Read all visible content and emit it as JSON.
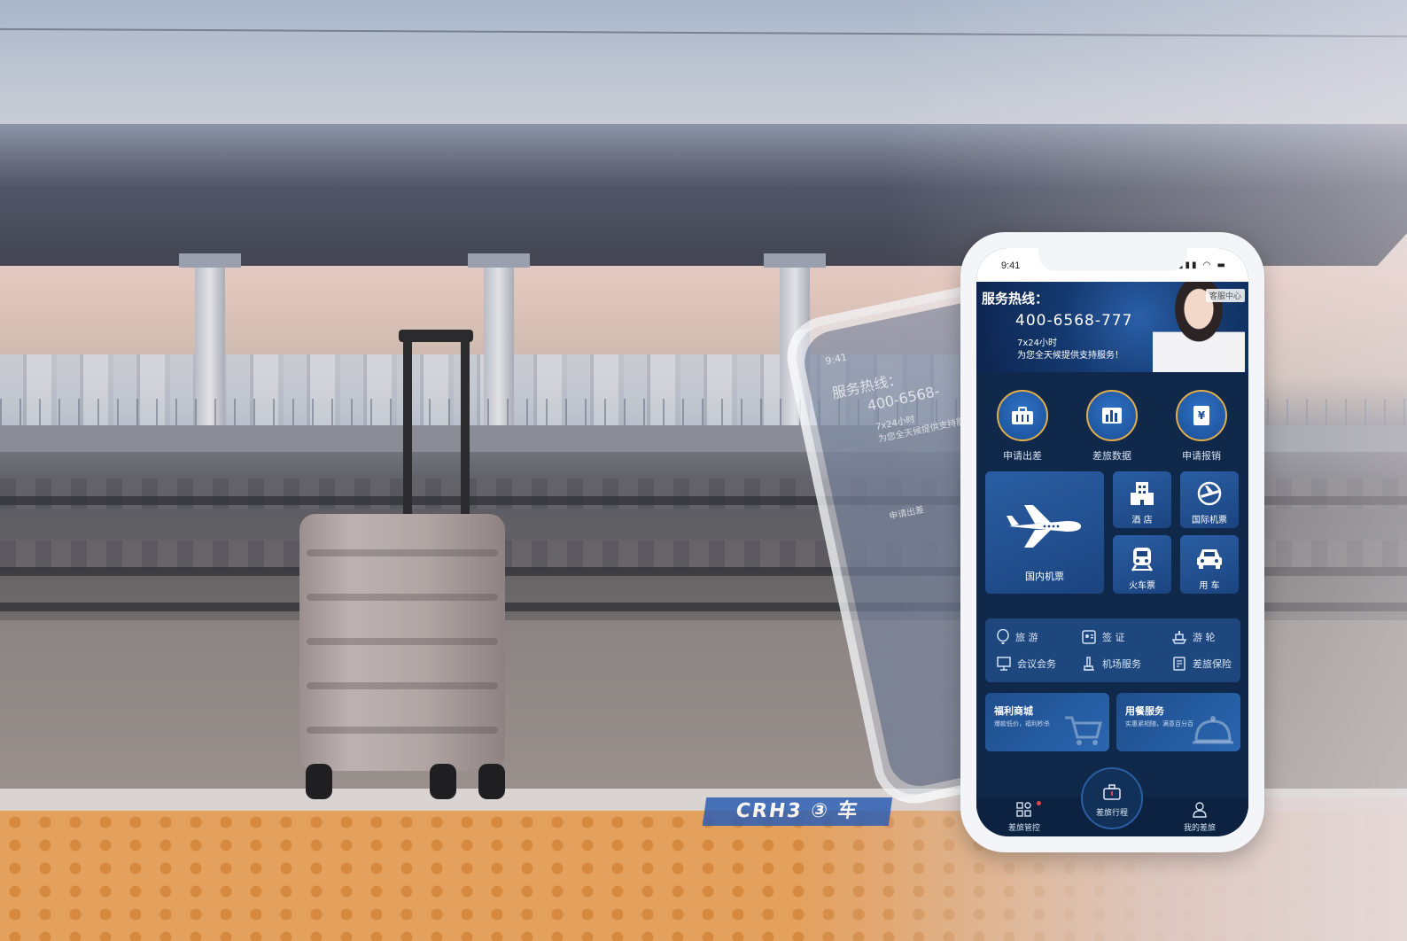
{
  "scene": {
    "platform_sign": "CRH3 ③ 车"
  },
  "ghost_phone": {
    "time": "9:41",
    "hotline_title": "服务热线：",
    "phone": "400-6568-",
    "hours": "7x24小时",
    "desc": "为您全天候提供支持服务",
    "apply_trip": "申请出差"
  },
  "phone": {
    "status": {
      "time": "9:41",
      "icons": "▮▮▮ ◠ ▬"
    },
    "banner": {
      "title": "服务热线：",
      "phone": "400-6568-777",
      "hours": "7x24小时",
      "desc": "为您全天候提供支持服务！",
      "badge": "客服中心"
    },
    "quick_actions": [
      {
        "label": "申请出差",
        "icon": "briefcase-icon"
      },
      {
        "label": "差旅数据",
        "icon": "bar-chart-icon"
      },
      {
        "label": "申请报销",
        "icon": "yen-receipt-icon"
      }
    ],
    "tiles": {
      "domestic_flight": {
        "label": "国内机票",
        "icon": "airplane-icon"
      },
      "hotel": {
        "label": "酒 店",
        "icon": "hotel-icon"
      },
      "intl_flight": {
        "label": "国际机票",
        "icon": "globe-plane-icon"
      },
      "train": {
        "label": "火车票",
        "icon": "train-icon"
      },
      "car": {
        "label": "用 车",
        "icon": "car-icon"
      }
    },
    "services": [
      {
        "label": "旅 游",
        "icon": "balloon-icon"
      },
      {
        "label": "签 证",
        "icon": "passport-icon"
      },
      {
        "label": "游 轮",
        "icon": "ship-icon"
      },
      {
        "label": "会议会务",
        "icon": "presentation-icon"
      },
      {
        "label": "机场服务",
        "icon": "airport-icon"
      },
      {
        "label": "差旅保险",
        "icon": "insurance-icon"
      }
    ],
    "promos": [
      {
        "title": "福利商城",
        "sub": "爆款低价，福利秒杀"
      },
      {
        "title": "用餐服务",
        "sub": "实惠紧相随，满意百分百"
      }
    ],
    "tabbar": {
      "left": "差旅管控",
      "center": "差旅行程",
      "right": "我的差旅"
    }
  },
  "colors": {
    "screen_bg": "#10284a",
    "tile_blue": "#2a5ea3",
    "gold_ring": "#e1ae4a",
    "notification_dot": "#e04a4a"
  }
}
